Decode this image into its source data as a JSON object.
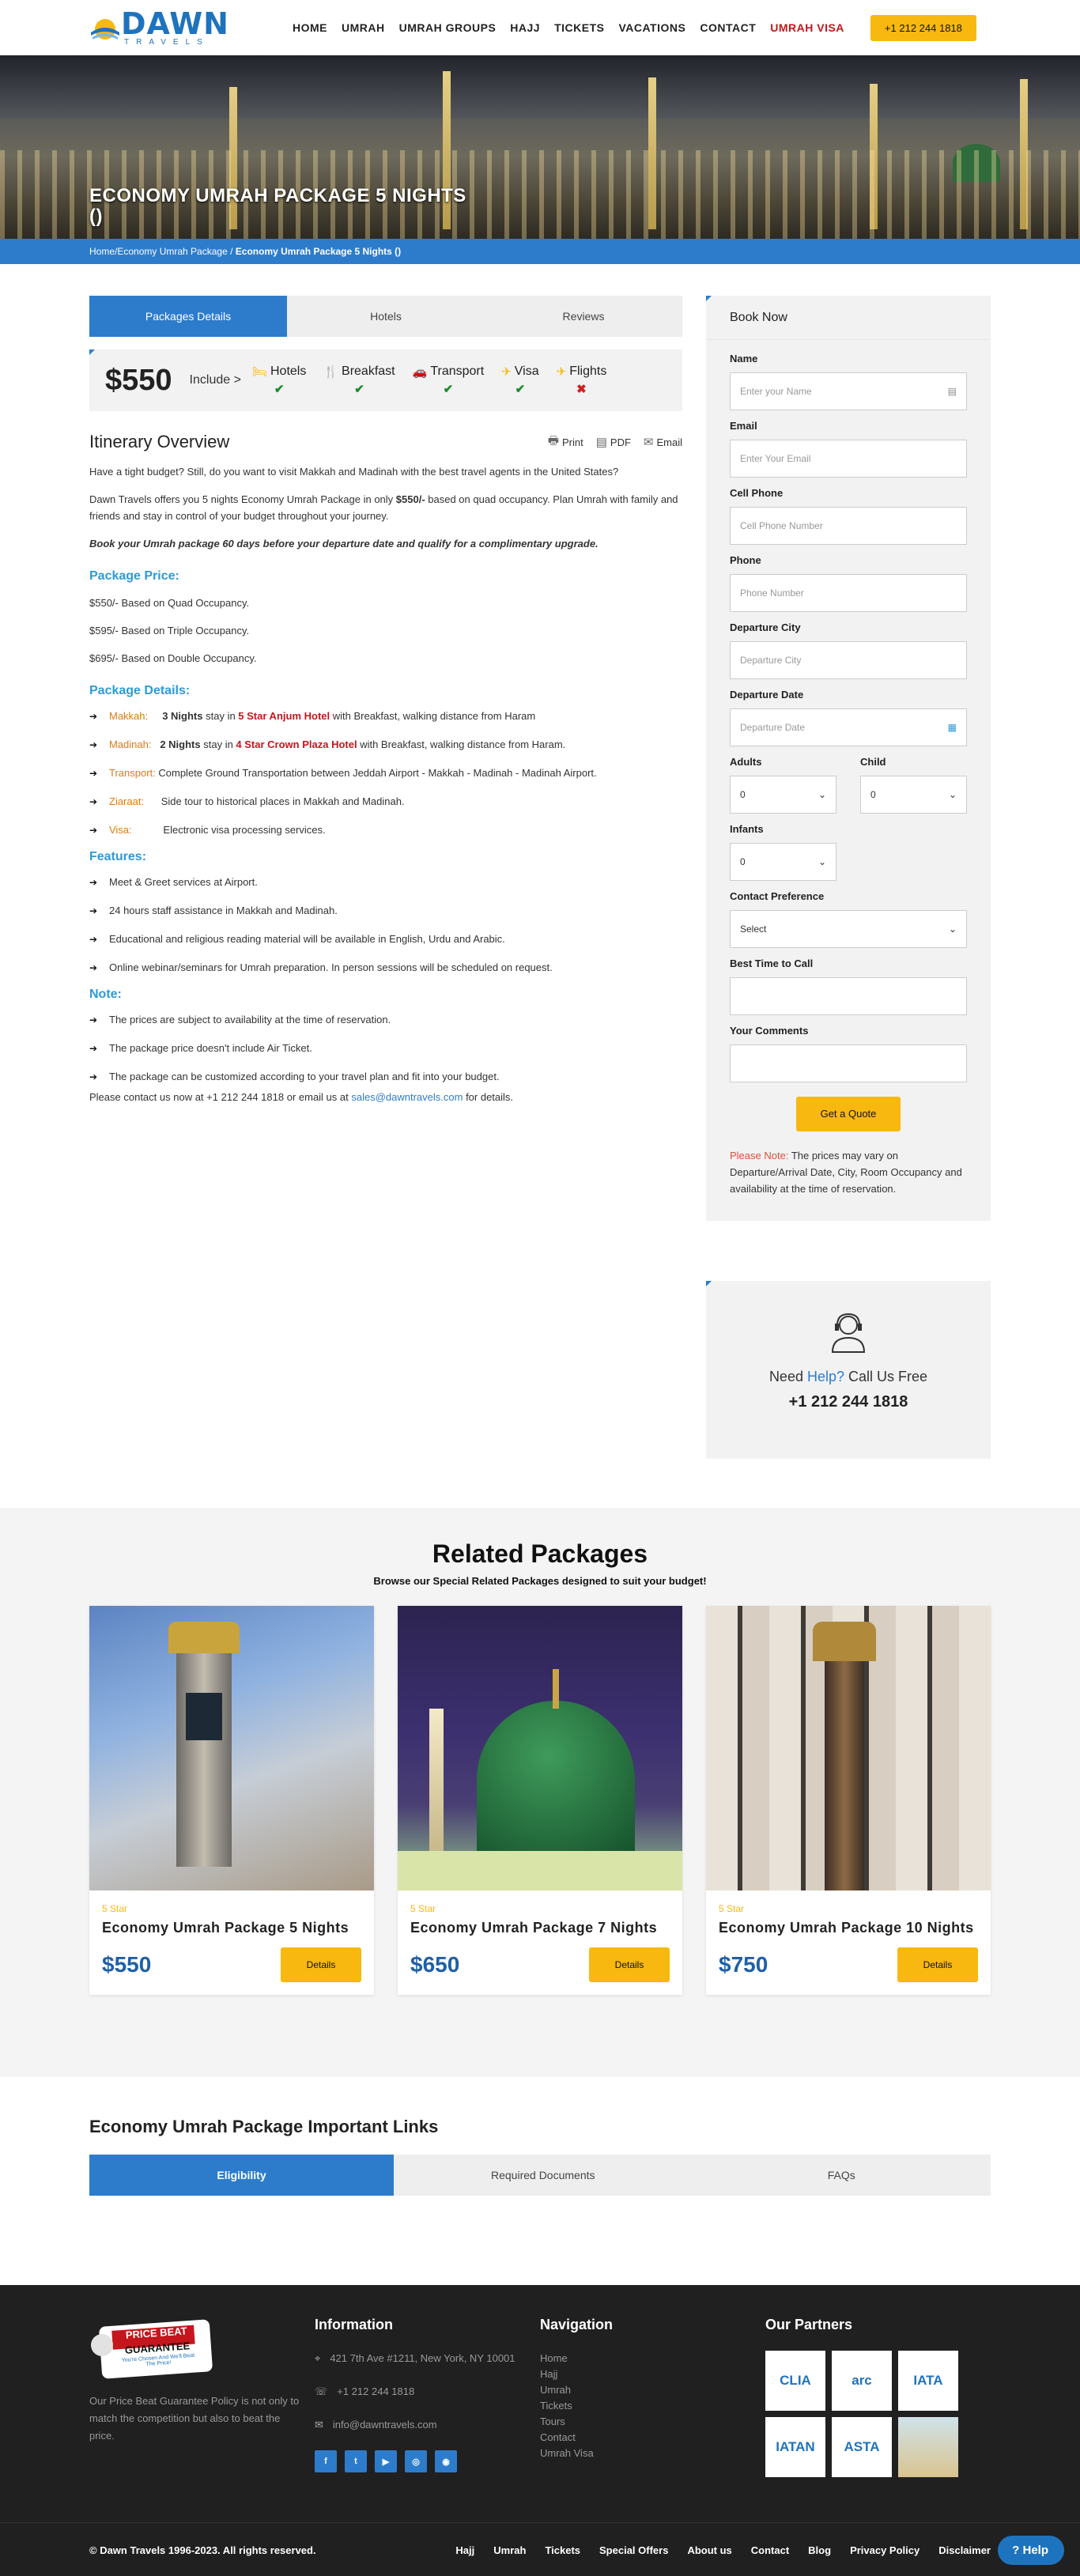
{
  "header": {
    "logo_main": "DAWN",
    "logo_sub": "TRAVELS",
    "nav": [
      "HOME",
      "UMRAH",
      "UMRAH GROUPS",
      "HAJJ",
      "TICKETS",
      "VACATIONS",
      "CONTACT",
      "UMRAH VISA"
    ],
    "phone": "+1 212 244 1818"
  },
  "hero": {
    "title_line1": "ECONOMY UMRAH PACKAGE 5 NIGHTS",
    "title_line2": "()"
  },
  "breadcrumb": {
    "home": "Home",
    "parent": "/Economy Umrah Package",
    "sep": "/",
    "current": "Economy Umrah Package 5 Nights ()"
  },
  "tabs": [
    "Packages Details",
    "Hotels",
    "Reviews"
  ],
  "pricebar": {
    "price": "$550",
    "include": "Include >",
    "features": [
      {
        "label": "Hotels",
        "icon": "bed-icon",
        "glyph": "🛏",
        "mark": "✔",
        "included": true
      },
      {
        "label": "Breakfast",
        "icon": "cutlery-icon",
        "glyph": "🍴",
        "mark": "✔",
        "included": true
      },
      {
        "label": "Transport",
        "icon": "car-icon",
        "glyph": "🚗",
        "mark": "✔",
        "included": true
      },
      {
        "label": "Visa",
        "icon": "visa-icon",
        "glyph": "✈",
        "mark": "✔",
        "included": true
      },
      {
        "label": "Flights",
        "icon": "plane-icon",
        "glyph": "✈",
        "mark": "✖",
        "included": false
      }
    ]
  },
  "itinerary": {
    "title": "Itinerary Overview",
    "print": "Print",
    "pdf": "PDF",
    "email": "Email",
    "intro": "Have a tight budget? Still, do you want to visit Makkah and Madinah with the best travel agents in the United States?",
    "p2_a": "Dawn Travels offers you 5 nights Economy Umrah Package in only ",
    "p2_price": "$550/-",
    "p2_b": " based on quad occupancy. Plan Umrah with family and friends and stay in control of your budget throughout your journey.",
    "bold_note": "Book your Umrah package 60 days before your departure date and qualify for a complimentary upgrade.",
    "price_head": "Package Price:",
    "prices": [
      "$550/- Based on Quad Occupancy.",
      "$595/- Based on Triple Occupancy.",
      "$695/- Based on Double Occupancy."
    ],
    "details_head": "Package Details:",
    "makkah_label": "Makkah:",
    "makkah_nights": "3 Nights",
    "makkah_stay": " stay in ",
    "makkah_hotel": "5 Star Anjum Hotel",
    "makkah_rest": " with Breakfast, walking distance from Haram",
    "madinah_label": "Madinah:",
    "madinah_nights": "2 Nights",
    "madinah_stay": " stay in ",
    "madinah_hotel": "4 Star Crown Plaza Hotel",
    "madinah_rest": " with Breakfast, walking distance from Haram.",
    "transport_label": "Transport:",
    "transport_text": " Complete Ground Transportation between Jeddah Airport - Makkah - Madinah - Madinah Airport.",
    "ziaraat_label": "Ziaraat:",
    "ziaraat_text": "Side tour to historical places in Makkah and Madinah.",
    "visa_label": "Visa:",
    "visa_text": "Electronic visa processing services.",
    "features_head": "Features:",
    "features": [
      "Meet & Greet services at Airport.",
      "24 hours staff assistance in Makkah and Madinah.",
      "Educational and religious reading material will be available in English, Urdu and Arabic.",
      "Online webinar/seminars for Umrah preparation. In person sessions will be scheduled on request."
    ],
    "note_head": "Note:",
    "notes": [
      "The prices are subject to availability at the time of reservation.",
      "The package price doesn't include Air Ticket.",
      "The package can be customized according to your travel plan and fit into your budget."
    ],
    "contact_a": "Please contact us now at +1 212 244 1818 or email us at ",
    "contact_email": "sales@dawntravels.com",
    "contact_b": " for details."
  },
  "book": {
    "title": "Book Now",
    "name_label": "Name",
    "name_ph": "Enter your Name",
    "email_label": "Email",
    "email_ph": "Enter Your Email",
    "cell_label": "Cell Phone",
    "cell_ph": "Cell Phone Number",
    "phone_label": "Phone",
    "phone_ph": "Phone Number",
    "city_label": "Departure City",
    "city_ph": "Departure City",
    "date_label": "Departure Date",
    "date_ph": "Departure Date",
    "adults_label": "Adults",
    "adults_val": "0",
    "child_label": "Child",
    "child_val": "0",
    "infants_label": "Infants",
    "infants_val": "0",
    "pref_label": "Contact Preference",
    "pref_val": "Select",
    "time_label": "Best Time to Call",
    "comments_label": "Your Comments",
    "button": "Get a Quote",
    "note_red": "Please Note:",
    "note_text": " The prices may vary on Departure/Arrival Date, City, Room Occupancy and availability at the time of reservation."
  },
  "help": {
    "need": "Need ",
    "help": "Help?",
    "call": " Call Us Free",
    "number": "+1 212 244 1818"
  },
  "related": {
    "title": "Related Packages",
    "subtitle": "Browse our Special Related Packages designed to suit your budget!",
    "cards": [
      {
        "star": "5 Star",
        "name": "Economy Umrah Package 5 Nights",
        "price": "$550",
        "button": "Details"
      },
      {
        "star": "5 Star",
        "name": "Economy Umrah Package 7 Nights",
        "price": "$650",
        "button": "Details"
      },
      {
        "star": "5 Star",
        "name": "Economy Umrah Package 10 Nights",
        "price": "$750",
        "button": "Details"
      }
    ]
  },
  "links": {
    "title": "Economy Umrah Package Important Links",
    "tabs": [
      "Eligibility",
      "Required Documents",
      "FAQs"
    ]
  },
  "footer": {
    "badge_1": "PRICE BEAT",
    "badge_2": "GUARANTEE",
    "badge_3": "You're Chosen And We'll Beat The Price!",
    "about": "Our Price Beat Guarantee Policy is not only to match the competition but also to beat the price.",
    "info_head": "Information",
    "address": "421 7th Ave #1211, New York, NY 10001",
    "phone": "+1 212 244 1818",
    "email": "info@dawntravels.com",
    "social": [
      "f",
      "t",
      "▶",
      "◎",
      "◉"
    ],
    "nav_head": "Navigation",
    "nav": [
      "Home",
      "Hajj",
      "Umrah",
      "Tickets",
      "Tours",
      "Contact",
      "Umrah Visa"
    ],
    "partners_head": "Our Partners",
    "partners": [
      "CLIA",
      "arc",
      "IATA",
      "IATAN",
      "ASTA",
      ""
    ],
    "copyright": "© Dawn Travels 1996-2023. All rights reserved.",
    "bottom_nav": [
      "Hajj",
      "Umrah",
      "Tickets",
      "Special Offers",
      "About us",
      "Contact",
      "Blog",
      "Privacy Policy",
      "Disclaimer"
    ],
    "help_btn": "Help"
  }
}
